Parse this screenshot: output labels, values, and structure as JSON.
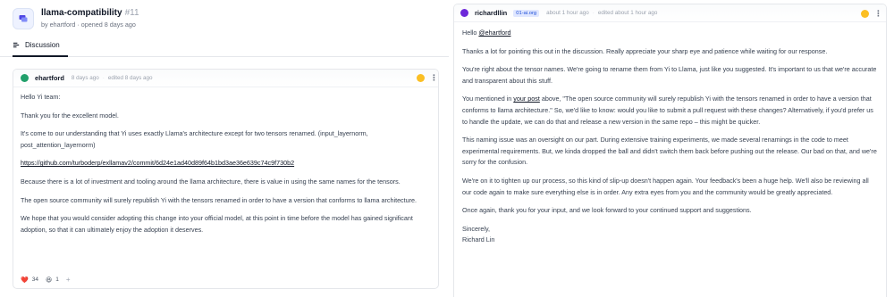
{
  "discussion": {
    "title": "llama-compatibility",
    "number": "#11",
    "opened_by": "by ehartford · opened 8 days ago",
    "tab_label": "Discussion"
  },
  "colors": {
    "accent": "#4f46e5",
    "avatar_ehartford": "#22a06b",
    "avatar_richardllin": "#6d28d9",
    "reaction_badge": "#fbbf24"
  },
  "comment1": {
    "author": "ehartford",
    "time": "8 days ago",
    "edited": "edited 8 days ago",
    "paragraphs": [
      "Hello Yi team:",
      "Thank you for the excellent model.",
      "It's come to our understanding that Yi uses exactly Llama's architecture except for two tensors renamed. (input_layernorm, post_attention_layernorm)",
      "https://github.com/turboderp/exllamav2/commit/6d24e1ad40d89f64b1bd3ae36e639c74c9f730b2",
      "Because there is a lot of investment and tooling around the llama architecture, there is value in using the same names for the tensors.",
      "The open source community will surely republish Yi with the tensors renamed in order to have a version that conforms to llama architecture.",
      "We hope that you would consider adopting this change into your official model, at this point in time before the model has gained significant adoption, so that it can ultimately enjoy the adoption it deserves."
    ],
    "reactions": [
      {
        "icon": "heart-icon",
        "emoji": "❤️",
        "count": "34"
      },
      {
        "icon": "laugh-icon",
        "emoji": "😆",
        "count": "1"
      }
    ],
    "add_reaction": "+"
  },
  "comment2": {
    "author": "richardllin",
    "org": "01-ai.org",
    "time": "about 1 hour ago",
    "edited": "edited about 1 hour ago",
    "greeting": "Hello",
    "mention": "@ehartford",
    "p1": "Thanks a lot for pointing this out in the discussion. Really appreciate your sharp eye and patience while waiting for our response.",
    "p2": "You're right about the tensor names. We're going to rename them from Yi to Llama, just like you suggested. It's important to us that we're accurate and transparent about this stuff.",
    "p3_pre": "You mentioned in",
    "p3_link": "your post",
    "p3_post": "above, \"The open source community will surely republish Yi with the tensors renamed in order to have a version that conforms to llama architecture.\" So, we'd like to know: would you like to submit a pull request with these changes? Alternatively, if you'd prefer us to handle the update, we can do that and release a new version in the same repo – this might be quicker.",
    "p4": "This naming issue was an oversight on our part. During extensive training experiments, we made several renamings in the code to meet experimental requirements. But, we kinda dropped the ball and didn't switch them back before pushing out the release. Our bad on that, and we're sorry for the confusion.",
    "p5": "We're on it to tighten up our process, so this kind of slip-up doesn't happen again. Your feedback's been a huge help. We'll also be reviewing all our code again to make sure everything else is in order. Any extra eyes from you and the community would be greatly appreciated.",
    "p6": "Once again, thank you for your input, and we look forward to your continued support and suggestions.",
    "signoff": "Sincerely,",
    "signature": "Richard Lin"
  }
}
